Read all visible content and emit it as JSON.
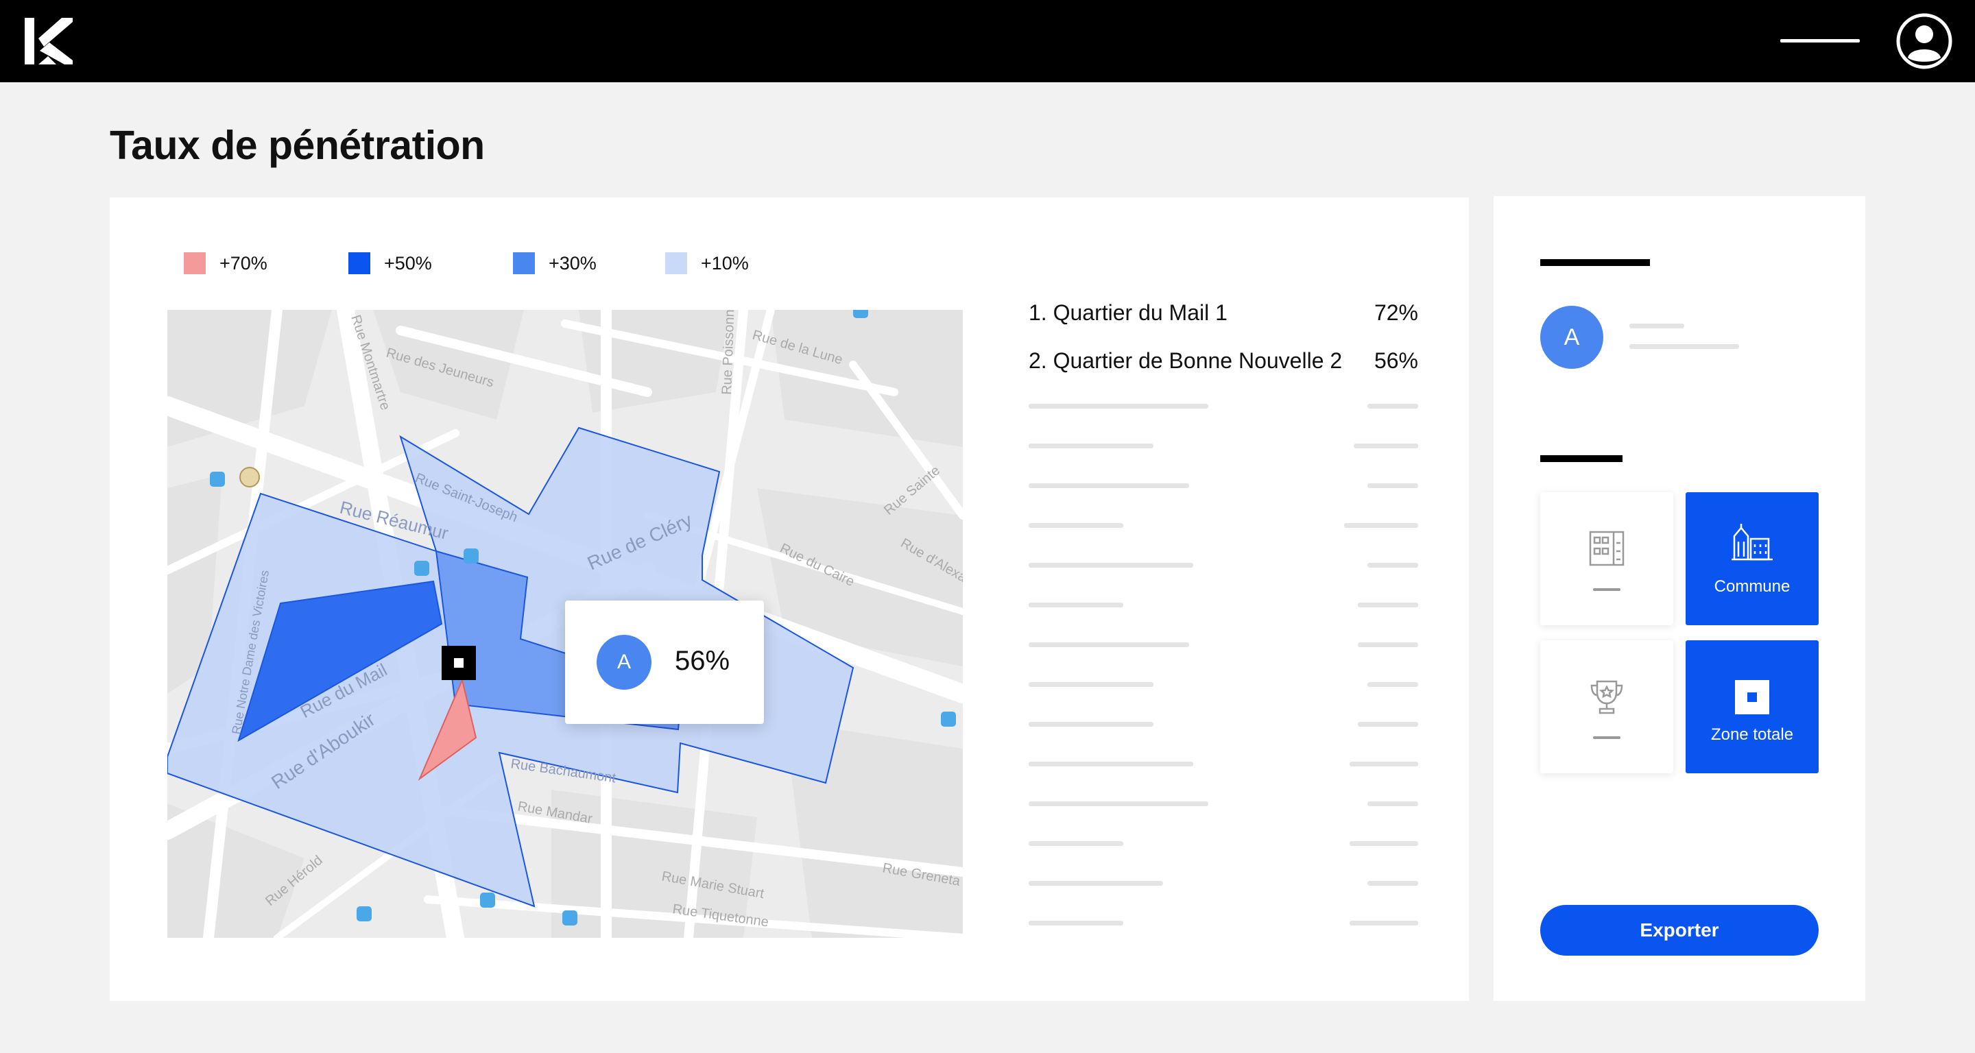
{
  "header": {
    "logo_icon": "brand-logo",
    "menu_icon": "menu-line-icon",
    "account_icon": "user-account-icon"
  },
  "page": {
    "title": "Taux de pénétration"
  },
  "legend": [
    {
      "label": "+70%",
      "color": "#f59a9a"
    },
    {
      "label": "+50%",
      "color": "#0a55f0"
    },
    {
      "label": "+30%",
      "color": "#4a86f0"
    },
    {
      "label": "+10%",
      "color": "#c9d9f8"
    }
  ],
  "map": {
    "street_labels": [
      "Rue Montmartre",
      "Rue des Jeuneurs",
      "Rue de la Lune",
      "Rue Poissonnière",
      "Rue Saint-Joseph",
      "Rue de Cléry",
      "Rue Réaumur",
      "Rue du Caire",
      "Rue du Mail",
      "Rue d'Aboukir",
      "Rue Bachaumont",
      "Rue Mandar",
      "Rue Marie Stuart",
      "Rue Tiquetonne",
      "Rue Greneta",
      "Rue Hérold",
      "Rue Notre Dame des Victoires",
      "Rue Sainte",
      "Rue d'Alexandrie"
    ],
    "tooltip": {
      "avatar_letter": "A",
      "value": "56%"
    }
  },
  "ranking": {
    "rows": [
      {
        "name": "1. Quartier du Mail 1",
        "value": "72%"
      },
      {
        "name": "2. Quartier de Bonne Nouvelle 2",
        "value": "56%"
      }
    ]
  },
  "side": {
    "avatar_letter": "A",
    "tiles": [
      {
        "icon": "building-grid-icon",
        "label": "",
        "active": false
      },
      {
        "icon": "city-buildings-icon",
        "label": "Commune",
        "active": true
      },
      {
        "icon": "trophy-icon",
        "label": "",
        "active": false
      },
      {
        "icon": "zone-square-icon",
        "label": "Zone totale",
        "active": true
      }
    ],
    "export_label": "Exporter"
  },
  "colors": {
    "accent": "#0a55f0",
    "accent_light": "#4a86f0",
    "background": "#f2f2f2",
    "header": "#000000"
  }
}
